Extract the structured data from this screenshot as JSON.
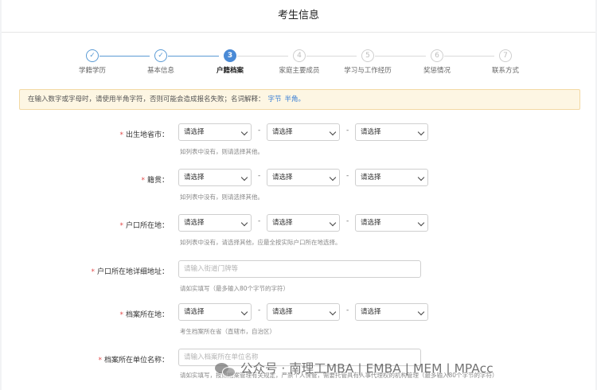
{
  "title": "考生信息",
  "steps": [
    {
      "number": "1",
      "label": "学籍学历",
      "status": "done"
    },
    {
      "number": "2",
      "label": "基本信息",
      "status": "done"
    },
    {
      "number": "3",
      "label": "户籍档案",
      "status": "active"
    },
    {
      "number": "4",
      "label": "家庭主要成员",
      "status": "todo"
    },
    {
      "number": "5",
      "label": "学习与工作经历",
      "status": "todo"
    },
    {
      "number": "6",
      "label": "奖惩情况",
      "status": "todo"
    },
    {
      "number": "7",
      "label": "联系方式",
      "status": "todo"
    }
  ],
  "step_check": "✓",
  "notice": {
    "text": "在输入数字或字母时，请使用半角字符，否则可能会造成报名失败；名词解释：",
    "link1": "字节",
    "link2": "半角。"
  },
  "form": {
    "required_mark": "*",
    "select_placeholder": "请选择",
    "separator": "-",
    "birthplace": {
      "label": "出生地省市：",
      "hint": "如列表中没有，则请选择其他。"
    },
    "native_place": {
      "label": "籍贯：",
      "hint": "如列表中没有，则请选择其他。"
    },
    "hukou": {
      "label": "户口所在地：",
      "hint": "如列表中没有，请选择其他，应最全按实际户口所在地选择。"
    },
    "hukou_address": {
      "label": "户口所在地详细地址：",
      "placeholder": "请输入街道门牌等",
      "hint": "请如实填写（最多输入80个字节的字符）"
    },
    "archive_location": {
      "label": "档案所在地：",
      "hint": "考生档案所在省（直辖市，自治区）"
    },
    "archive_unit": {
      "label": "档案所在单位名称：",
      "placeholder": "请输入档案所在单位名称",
      "hint": "请如实填写，按照档案管理有关规定，严禁个人保管，需要托管具有人事代理权的机构管理（最多输入80个字节的字符）"
    }
  },
  "watermark": "公众号 · 南理工MBA | EMBA | MEM | MPAcc",
  "colors": {
    "accent": "#4a8ad6",
    "required": "#e24b4b",
    "notice_bg": "#fdf6e3",
    "notice_border": "#f3d9a4"
  }
}
